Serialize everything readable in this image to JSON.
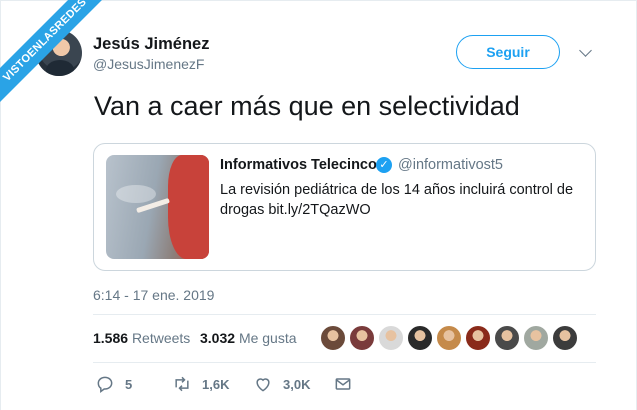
{
  "watermark": "VISTOENLASREDES",
  "author": {
    "name": "Jesús Jiménez",
    "handle": "@JesusJimenezF"
  },
  "follow_label": "Seguir",
  "tweet_text": "Van a caer más que en selectividad",
  "quoted": {
    "name": "Informativos Telecinco",
    "verified": true,
    "handle": "@informativost5",
    "text": "La revisión pediátrica de los 14 años incluirá control de drogas bit.ly/2TQazWO"
  },
  "timestamp": "6:14 - 17 ene. 2019",
  "stats": {
    "retweets_count": "1.586",
    "retweets_label": "Retweets",
    "likes_count": "3.032",
    "likes_label": "Me gusta"
  },
  "likers": [
    {
      "color": "#6b4a3a"
    },
    {
      "color": "#7a3b3b"
    },
    {
      "color": "#d9d9d9"
    },
    {
      "color": "#2a2a2a"
    },
    {
      "color": "#c58a4a"
    },
    {
      "color": "#8a2a1a"
    },
    {
      "color": "#4a4a4a"
    },
    {
      "color": "#a0a8a0"
    },
    {
      "color": "#3c3c3c"
    }
  ],
  "actions": {
    "reply_count": "5",
    "retweet_count": "1,6K",
    "like_count": "3,0K"
  },
  "colors": {
    "accent": "#1da1f2",
    "muted": "#657786",
    "border": "#e6ecf0"
  }
}
